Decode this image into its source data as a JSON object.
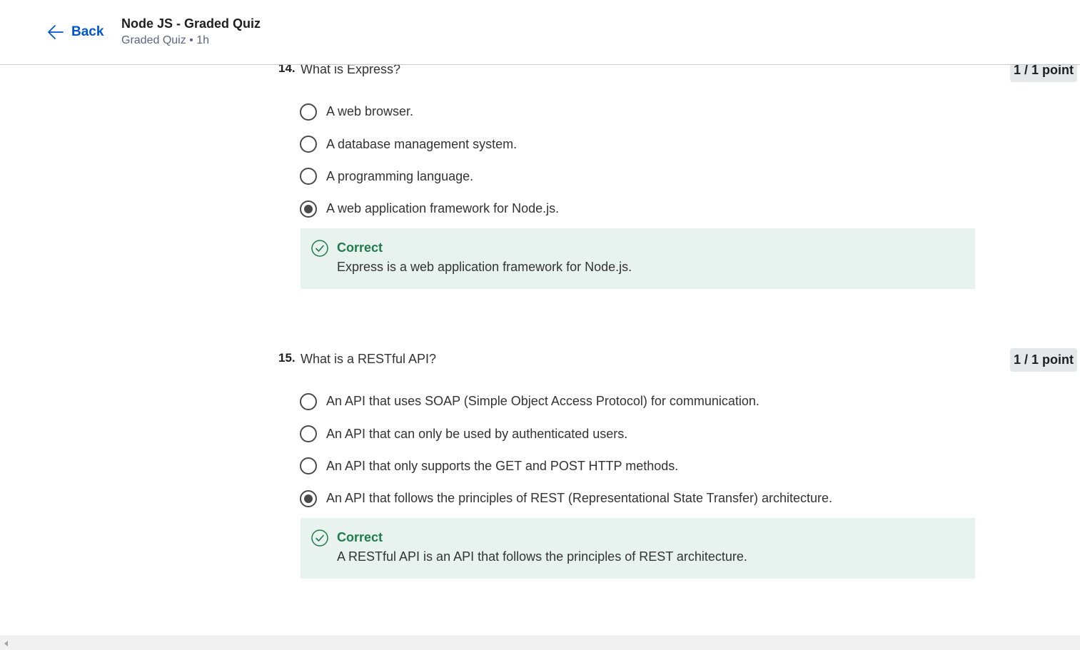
{
  "header": {
    "back_label": "Back",
    "title": "Node JS - Graded Quiz",
    "subtitle": "Graded Quiz • 1h"
  },
  "questions": [
    {
      "number": "14.",
      "text": "What is Express?",
      "points": "1 / 1 point",
      "options": [
        {
          "label": "A web browser.",
          "selected": false
        },
        {
          "label": "A database management system.",
          "selected": false
        },
        {
          "label": "A programming language.",
          "selected": false
        },
        {
          "label": "A web application framework for Node.js.",
          "selected": true
        }
      ],
      "feedback": {
        "status": "Correct",
        "text": "Express is a web application framework for Node.js."
      }
    },
    {
      "number": "15.",
      "text": "What is a RESTful API?",
      "points": "1 / 1 point",
      "options": [
        {
          "label": "An API that uses SOAP (Simple Object Access Protocol) for communication.",
          "selected": false
        },
        {
          "label": "An API that can only be used by authenticated users.",
          "selected": false
        },
        {
          "label": "An API that only supports the GET and POST HTTP methods.",
          "selected": false
        },
        {
          "label": "An API that follows the principles of REST (Representational State Transfer) architecture.",
          "selected": true
        }
      ],
      "feedback": {
        "status": "Correct",
        "text": "A RESTful API is an API that follows the principles of REST architecture."
      }
    }
  ],
  "colors": {
    "link": "#0056d2",
    "correct": "#1f7a4c",
    "feedback_bg": "#e8f2ee",
    "points_bg": "#e5e7e8"
  },
  "icons": {
    "back": "arrow-left-icon",
    "correct": "check-circle-icon",
    "scroll": "scroll-left-arrow-icon"
  }
}
